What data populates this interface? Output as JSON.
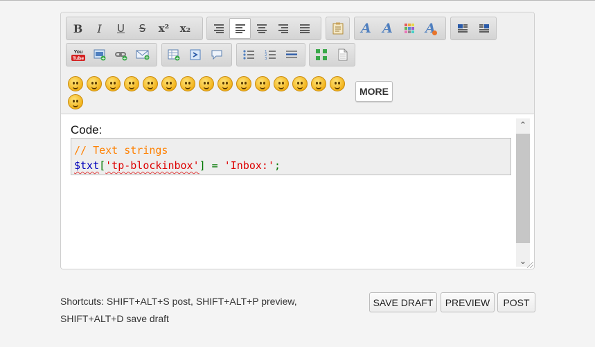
{
  "editor": {
    "toolbar_row1": [
      {
        "name": "bold",
        "glyph": "B"
      },
      {
        "name": "italic",
        "glyph": "I"
      },
      {
        "name": "underline",
        "glyph": "U"
      },
      {
        "name": "strikethrough",
        "glyph": "S"
      },
      {
        "name": "superscript",
        "glyph": "x²"
      },
      {
        "name": "subscript",
        "glyph": "x₂"
      }
    ],
    "more_label": "MORE",
    "smiley_count": 15
  },
  "content": {
    "code_label": "Code:",
    "code": {
      "comment": "// Text strings",
      "var": "$txt",
      "open": "[",
      "key": "'tp-blockinbox'",
      "close": "]",
      "eq": " = ",
      "value": "'Inbox:'",
      "semi": ";"
    }
  },
  "footer": {
    "shortcuts_line1": "Shortcuts: SHIFT+ALT+S post, SHIFT+ALT+P preview,",
    "shortcuts_line2": "SHIFT+ALT+D save draft",
    "save_draft": "SAVE DRAFT",
    "preview": "PREVIEW",
    "post": "POST"
  }
}
